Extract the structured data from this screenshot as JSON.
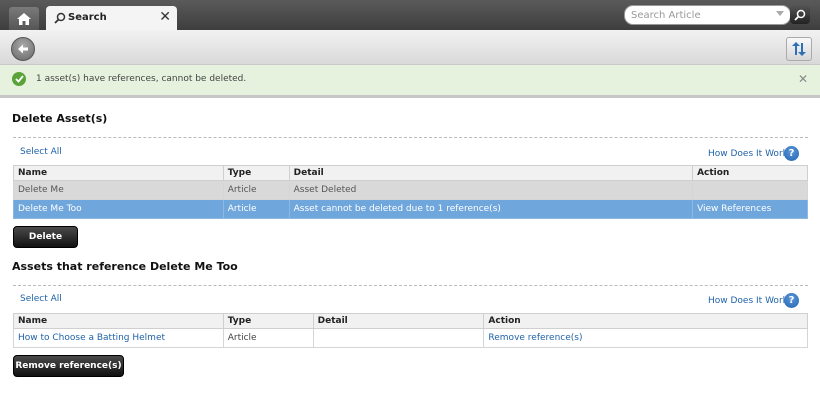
{
  "header": {
    "home_icon": "home-icon",
    "tab": {
      "label": "Search",
      "icon": "search-icon"
    },
    "search": {
      "placeholder": "Search Article"
    }
  },
  "toolbar": {
    "back_icon": "back-arrow-icon",
    "sync_icon": "sync-icon"
  },
  "notification": {
    "text": "1 asset(s) have references, cannot be deleted.",
    "status_color": "#5aa33a"
  },
  "delete_section": {
    "title": "Delete Asset(s)",
    "select_all": "Select All",
    "how_link": "How Does It Work?",
    "columns": [
      "Name",
      "Type",
      "Detail",
      "Action"
    ],
    "rows": [
      {
        "name": "Delete Me",
        "type": "Article",
        "detail": "Asset Deleted",
        "action": ""
      },
      {
        "name": "Delete Me Too",
        "type": "Article",
        "detail": "Asset cannot be deleted due to 1 reference(s)",
        "action": "View References"
      }
    ],
    "button": "Delete"
  },
  "refs_section": {
    "title": "Assets that reference Delete Me Too",
    "select_all": "Select All",
    "how_link": "How Does It Work?",
    "columns": [
      "Name",
      "Type",
      "Detail",
      "Action"
    ],
    "rows": [
      {
        "name": "How to Choose a Batting Helmet",
        "type": "Article",
        "detail": "",
        "action": "Remove reference(s)"
      }
    ],
    "button": "Remove reference(s)"
  },
  "colors": {
    "selected_row": "#6fa6dc",
    "link": "#1f62a8"
  }
}
